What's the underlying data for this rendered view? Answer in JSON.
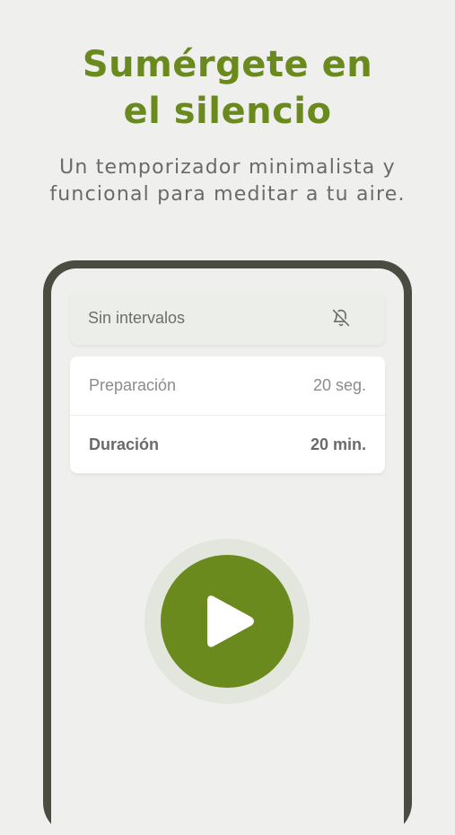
{
  "headline": {
    "line1": "Sumérgete en",
    "line2": "el silencio"
  },
  "subtitle": {
    "line1": "Un temporizador minimalista y",
    "line2": "funcional para meditar a tu aire."
  },
  "timer": {
    "intervals_label": "Sin intervalos",
    "intervals_icon": "bell-off-icon",
    "preparation": {
      "label": "Preparación",
      "value": "20 seg."
    },
    "duration": {
      "label": "Duración",
      "value": "20 min."
    },
    "play_icon": "play-icon"
  },
  "colors": {
    "accent": "#6b8a1e",
    "background": "#eff0ed",
    "phone_frame": "#4a4c42",
    "text_muted": "#8b8b88",
    "text_dark": "#6a6a68"
  }
}
